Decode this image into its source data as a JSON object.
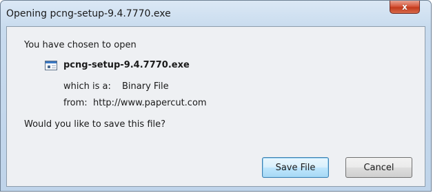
{
  "window": {
    "title": "Opening pcng-setup-9.4.7770.exe",
    "close_glyph": "x"
  },
  "dialog": {
    "heading": "You have chosen to open",
    "filename": "pcng-setup-9.4.7770.exe",
    "file_icon": "executable-file-icon",
    "which_label": "which is a:",
    "which_value": "Binary File",
    "from_label": "from:",
    "from_value": "http://www.papercut.com",
    "question": "Would you like to save this file?"
  },
  "buttons": {
    "save_label": "Save File",
    "cancel_label": "Cancel"
  },
  "colors": {
    "close_button": "#c23a1c",
    "default_button_border": "#3c7fb1"
  }
}
